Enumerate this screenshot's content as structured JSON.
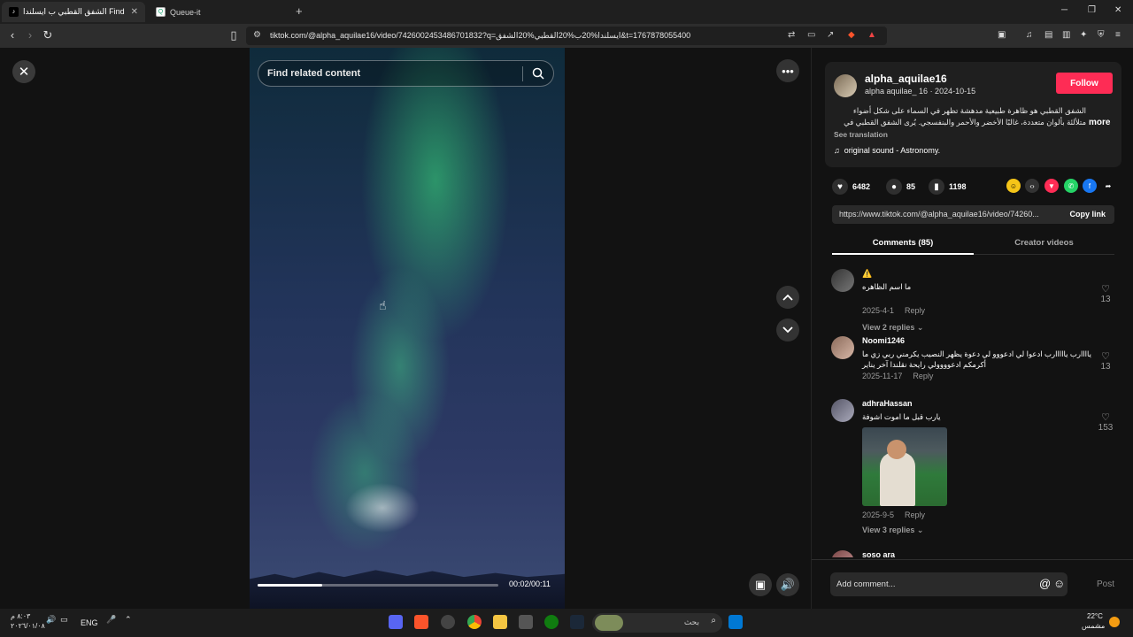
{
  "browser": {
    "tabs": [
      {
        "title": "الشفق القطبي ب ايسلندا Find",
        "active": true
      },
      {
        "title": "Queue-it",
        "active": false
      }
    ],
    "new_tab_icon": "plus-icon",
    "url": "tiktok.com/@alpha_aquilae16/video/7426002453486701832?q=ايسلندا%20ب%20القطبي%20الشفق&t=1767878055400"
  },
  "video": {
    "search_placeholder": "Find related content",
    "time": "00:02/00:11",
    "progress": 0.27
  },
  "post": {
    "username": "alpha_aquilae16",
    "subline": "alpha aquilae_ 16 · 2024-10-15",
    "follow_label": "Follow",
    "description": "الشفق القطبي هو ظاهرة طبيعية مدهشة تظهر في السماء على شكل أضواء متلألئة بألوان متعددة، غالبًا الأخضر والأحمر والبنفسجي. يُرى الشفق القطبي في المناطق القريبة",
    "more_label": "more",
    "see_translation": "See translation",
    "sound": "original sound - Astronomy.",
    "likes": "6482",
    "comments_count": "85",
    "saves": "1198",
    "link": "https://www.tiktok.com/@alpha_aquilae16/video/74260...",
    "copy_label": "Copy link",
    "tab_comments": "Comments (85)",
    "tab_creator": "Creator videos"
  },
  "comments": [
    {
      "name": "⚠️",
      "text": "ما اسم الظاهره",
      "date": "2025-4-1",
      "reply": "Reply",
      "replies": "View 2 replies",
      "likes": "13"
    },
    {
      "name": "Noomi1246",
      "text": "ياااارب يااااارب ادعوا لي ادعووو لي دعوة يظهر النصيب يكرمني ربي زي ما أكرمكم ادعوووولي رايحة نقلندا آخر يناير",
      "date": "2025-11-17",
      "reply": "Reply",
      "replies": "",
      "likes": "13"
    },
    {
      "name": "adhraHassan",
      "text": "يارب قبل ما اموت اشوفة",
      "date": "2025-9-5",
      "reply": "Reply",
      "replies": "View 3 replies",
      "likes": "153"
    },
    {
      "name": "soso ara",
      "text": "",
      "date": "",
      "reply": "",
      "replies": "",
      "likes": ""
    }
  ],
  "add_comment": {
    "placeholder": "Add comment...",
    "post_label": "Post"
  },
  "taskbar": {
    "date": "٢٠٢٦/٠١/٠٨",
    "time": "٨:٠٣ م",
    "lang": "ENG",
    "search": "بحث",
    "weather_temp": "22°C",
    "weather_desc": "مشمس"
  }
}
